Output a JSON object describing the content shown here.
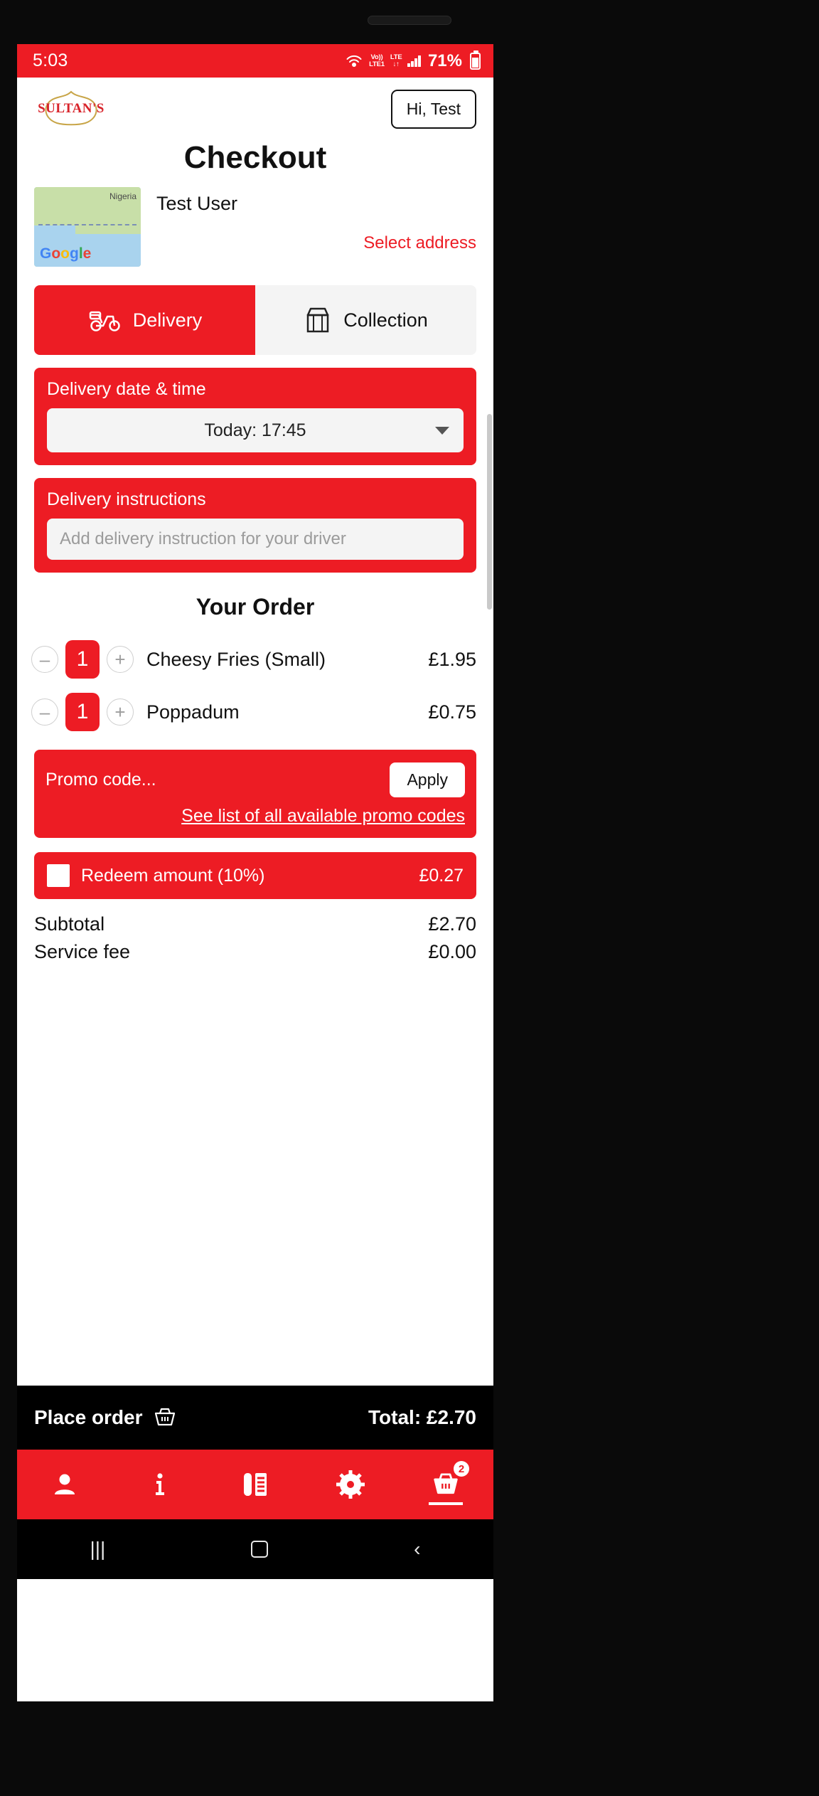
{
  "status_bar": {
    "time": "5:03",
    "volte_line1": "Vo))",
    "volte_line2": "LTE1",
    "lte_line1": "LTE",
    "lte_line2": "↓↑",
    "battery_percent": "71%",
    "icons": [
      "hotspot-icon",
      "volte-icon",
      "lte-icon",
      "signal-bars-icon",
      "battery-icon"
    ]
  },
  "header": {
    "logo_text": "SULTAN'S",
    "greeting_button": "Hi, Test"
  },
  "page_title": "Checkout",
  "address": {
    "map_country_label": "Nigeria",
    "map_brand": "Google",
    "user_name": "Test User",
    "select_address_link": "Select address"
  },
  "fulfilment": {
    "delivery_label": "Delivery",
    "collection_label": "Collection",
    "selected": "Delivery"
  },
  "delivery_datetime": {
    "heading": "Delivery date & time",
    "selected_value": "Today: 17:45"
  },
  "delivery_instructions": {
    "heading": "Delivery instructions",
    "placeholder": "Add delivery instruction for your driver",
    "value": ""
  },
  "order": {
    "section_title": "Your Order",
    "items": [
      {
        "qty": "1",
        "name": "Cheesy Fries (Small)",
        "price": "£1.95",
        "decrement": "–",
        "increment": "+"
      },
      {
        "qty": "1",
        "name": "Poppadum",
        "price": "£0.75",
        "decrement": "–",
        "increment": "+"
      }
    ]
  },
  "promo": {
    "placeholder": "Promo code...",
    "value": "",
    "apply_label": "Apply",
    "list_link": "See list of all available promo codes"
  },
  "redeem": {
    "label": "Redeem amount (10%)",
    "amount": "£0.27",
    "checked": false
  },
  "totals": [
    {
      "label": "Subtotal",
      "value": "£2.70"
    },
    {
      "label": "Service fee",
      "value": "£0.00"
    }
  ],
  "action_bar": {
    "place_order_label": "Place order",
    "basket_icon": "basket-icon",
    "total_label": "Total: £2.70"
  },
  "tabbar": {
    "items": [
      {
        "name": "account",
        "icon": "person-icon",
        "active": false,
        "badge": ""
      },
      {
        "name": "info",
        "icon": "info-icon",
        "active": false,
        "badge": ""
      },
      {
        "name": "menu",
        "icon": "menu-book-icon",
        "active": false,
        "badge": ""
      },
      {
        "name": "settings",
        "icon": "gear-icon",
        "active": false,
        "badge": ""
      },
      {
        "name": "basket",
        "icon": "basket-icon",
        "active": true,
        "badge": "2"
      }
    ]
  },
  "android_nav": {
    "recents": "|||",
    "home": "home-square-icon",
    "back": "‹"
  },
  "colors": {
    "brand_red": "#ED1C24",
    "logo_gold": "#C8A548",
    "logo_red": "#D8232A",
    "field_gray": "#F4F4F4",
    "text_dark": "#111111"
  }
}
